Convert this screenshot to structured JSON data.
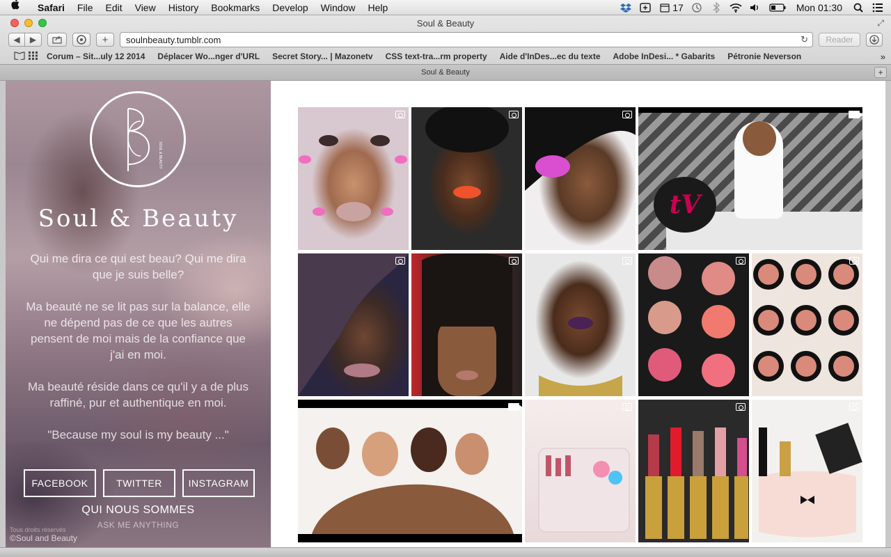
{
  "menubar": {
    "app_name": "Safari",
    "items": [
      "File",
      "Edit",
      "View",
      "History",
      "Bookmarks",
      "Develop",
      "Window",
      "Help"
    ],
    "status": {
      "badge_count": "17",
      "clock": "Mon 01:30"
    }
  },
  "window": {
    "title": "Soul & Beauty"
  },
  "toolbar": {
    "url": "soulnbeauty.tumblr.com",
    "reader_label": "Reader"
  },
  "bookmarks": [
    "Corum – Sit...uly 12 2014",
    "Déplacer Wo...nger d'URL",
    "Secret Story... | Mazonetv",
    "CSS text-tra...rm property",
    "Aide d'InDes...ec du texte",
    "Adobe InDesi... * Gabarits",
    "Pétronie Neverson"
  ],
  "tab": {
    "title": "Soul & Beauty"
  },
  "sidebar": {
    "logo_small_text": "SOUL & BEAUTY",
    "brand": "Soul & Beauty",
    "paragraphs": [
      "Qui me dira ce qui est beau? Qui me dira que je suis belle?",
      "Ma beauté ne se lit pas sur la balance, elle ne dépend pas de ce que les autres pensent de moi mais de la confiance que j'ai en moi.",
      "Ma beauté réside dans ce qu'il y a de plus raffiné, pur et authentique en moi.",
      "\"Because my soul is my beauty ...\""
    ],
    "social": [
      "FACEBOOK",
      "TWITTER",
      "INSTAGRAM"
    ],
    "about_link": "QUI NOUS SOMMES",
    "ask_link": "ASK ME ANYTHING",
    "footer_rights": "Tous droits réservés",
    "footer_copy": "©Soul and Beauty"
  },
  "video_logo": "tV",
  "colors": {
    "accent_magenta": "#c8004f",
    "page_bg": "#ffffff"
  }
}
